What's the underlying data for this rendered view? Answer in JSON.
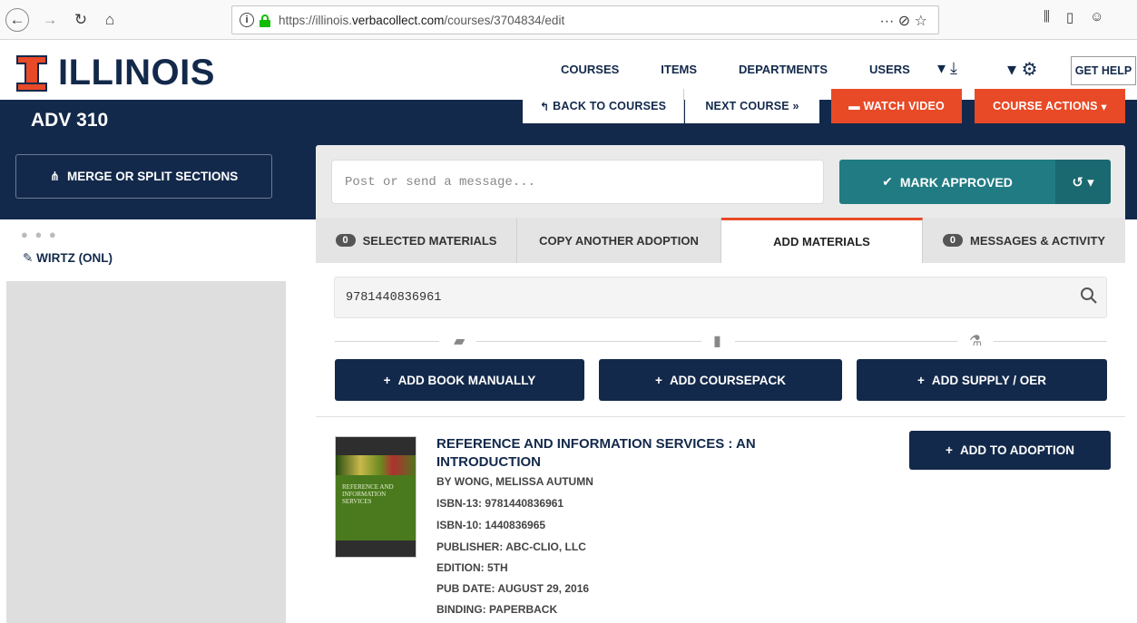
{
  "browser": {
    "url_prefix": "https://illinois.",
    "url_domain": "verbacollect.com",
    "url_path": "/courses/3704834/edit",
    "url_actions": "··· ⊘ ☆"
  },
  "header": {
    "logo_text": "ILLINOIS",
    "nav": [
      "COURSES",
      "ITEMS",
      "DEPARTMENTS",
      "USERS"
    ],
    "get_help": "GET HELP"
  },
  "course": {
    "title": "ADV 310",
    "back": "BACK TO COURSES",
    "next": "NEXT COURSE",
    "video": "WATCH VIDEO",
    "actions": "COURSE ACTIONS"
  },
  "sidebar": {
    "merge_label": "MERGE OR SPLIT SECTIONS",
    "dots": "● ● ●",
    "section": "WIRTZ (ONL)"
  },
  "message": {
    "placeholder": "Post or send a message...",
    "approve": "MARK APPROVED"
  },
  "tabs": {
    "selected_count": "0",
    "selected_label": "SELECTED MATERIALS",
    "copy_label": "COPY ANOTHER ADOPTION",
    "add_label": "ADD MATERIALS",
    "msg_count": "0",
    "msg_label": "MESSAGES & ACTIVITY"
  },
  "search": {
    "value": "9781440836961"
  },
  "add_buttons": {
    "book": "ADD BOOK MANUALLY",
    "coursepack": "ADD COURSEPACK",
    "supply": "ADD SUPPLY / OER"
  },
  "book": {
    "title": "REFERENCE AND INFORMATION SERVICES : AN INTRODUCTION",
    "author": "BY WONG, MELISSA AUTUMN",
    "isbn13": "ISBN-13: 9781440836961",
    "isbn10": "ISBN-10: 1440836965",
    "publisher": "PUBLISHER: ABC-CLIO, LLC",
    "edition": "EDITION: 5TH",
    "pub_date": "PUB DATE: AUGUST 29, 2016",
    "binding": "BINDING: PAPERBACK",
    "add_label": "ADD TO ADOPTION",
    "cover_text": "REFERENCE AND INFORMATION SERVICES"
  },
  "colors": {
    "navy": "#13294b",
    "orange": "#e84a27",
    "teal": "#217b83"
  }
}
